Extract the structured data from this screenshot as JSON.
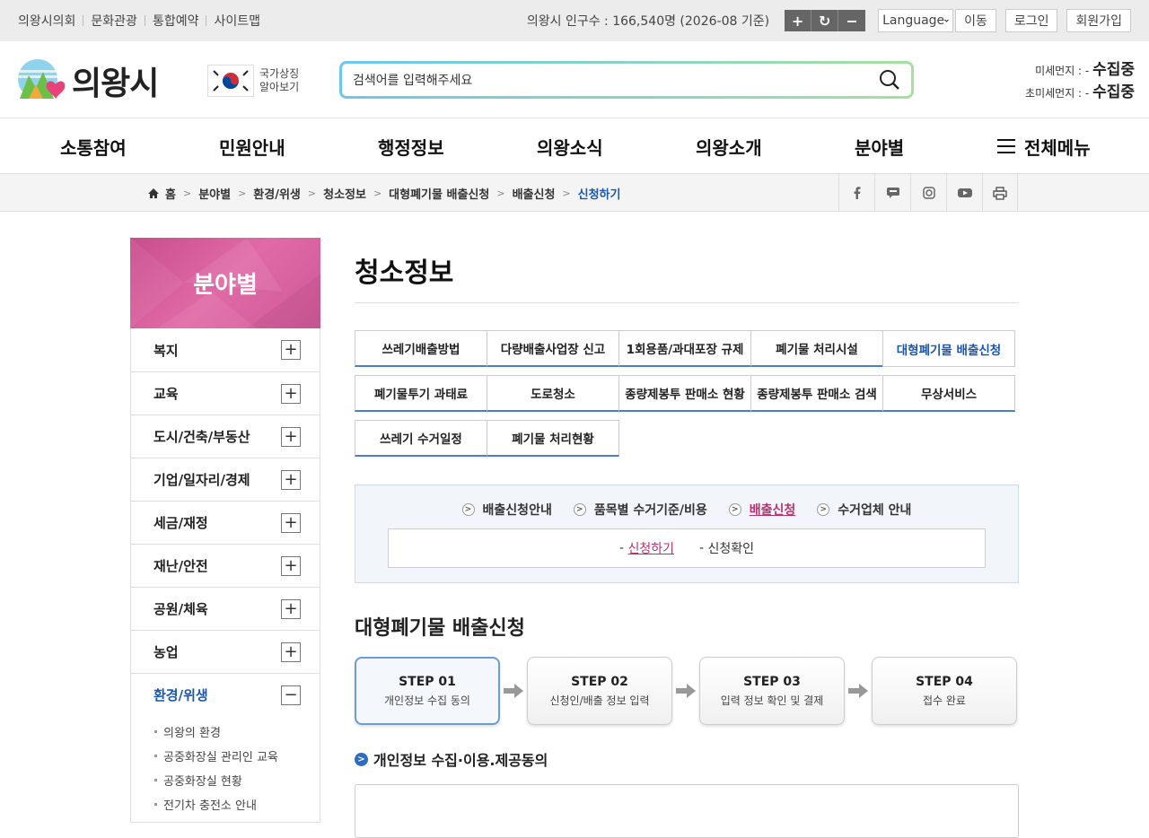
{
  "topbar": {
    "links": [
      "의왕시의회",
      "문화관광",
      "통합예약",
      "사이트맵"
    ],
    "population": "의왕시 인구수 : 166,540명 (2026-08 기준)",
    "zoom_in": "+",
    "zoom_reset": "↻",
    "zoom_out": "−",
    "language": "Language",
    "go": "이동",
    "login": "로그인",
    "signup": "회원가입"
  },
  "header": {
    "logo_text": "의왕시",
    "symbol_line1": "국가상징",
    "symbol_line2": "알아보기",
    "search_placeholder": "검색어를 입력해주세요",
    "dust_label": "미세먼지 : -",
    "dust_value": "수집중",
    "finedust_label": "초미세먼지 : -",
    "finedust_value": "수집중"
  },
  "gnb": [
    "소통참여",
    "민원안내",
    "행정정보",
    "의왕소식",
    "의왕소개",
    "분야별",
    "전체메뉴"
  ],
  "breadcrumb": [
    "홈",
    "분야별",
    "환경/위생",
    "청소정보",
    "대형폐기물 배출신청",
    "배출신청",
    "신청하기"
  ],
  "sns": [
    "f",
    "talk",
    "ig",
    "yt",
    "print"
  ],
  "lnb": {
    "title": "분야별",
    "items": [
      "복지",
      "교육",
      "도시/건축/부동산",
      "기업/일자리/경제",
      "세금/재정",
      "재난/안전",
      "공원/체육",
      "농업",
      "환경/위생"
    ],
    "sub_items": [
      "의왕의 환경",
      "공중화장실 관리인 교육",
      "공중화장실 현황",
      "전기차 충전소 안내"
    ]
  },
  "page": {
    "title": "청소정보",
    "tabs": [
      "쓰레기배출방법",
      "다량배출사업장 신고",
      "1회용품/과대포장 규제",
      "폐기물 처리시설",
      "대형폐기물 배출신청",
      "폐기물투기 과태료",
      "도로청소",
      "종량제봉투 판매소 현황",
      "종량제봉투 판매소 검색",
      "무상서비스",
      "쓰레기 수거일정",
      "폐기물 처리현황"
    ],
    "subnav": [
      "배출신청안내",
      "품목별 수거기준/비용",
      "배출신청",
      "수거업체 안내"
    ],
    "subnav2_apply": "신청하기",
    "subnav2_check": "신청확인",
    "section_title": "대형폐기물 배출신청",
    "steps": [
      {
        "num": "STEP 01",
        "desc": "개인정보 수집 동의"
      },
      {
        "num": "STEP 02",
        "desc": "신청인/배출 정보 입력"
      },
      {
        "num": "STEP 03",
        "desc": "입력 정보 확인 및 결제"
      },
      {
        "num": "STEP 04",
        "desc": "접수 완료"
      }
    ],
    "agree_title": "개인정보 수집·이용.제공동의"
  },
  "colors": {
    "accent": "#1a56b0",
    "pink": "#b8336f"
  }
}
